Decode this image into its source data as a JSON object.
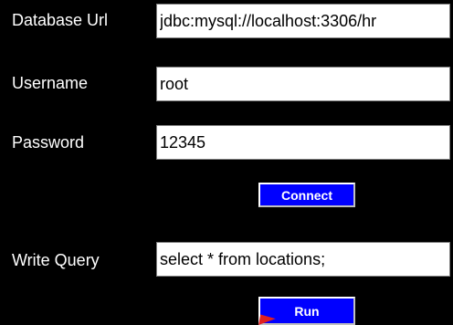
{
  "form": {
    "db_url": {
      "label": "Database Url",
      "value": "jdbc:mysql://localhost:3306/hr"
    },
    "username": {
      "label": "Username",
      "value": "root"
    },
    "password": {
      "label": "Password",
      "value": "12345"
    },
    "connect_label": "Connect",
    "query": {
      "label": "Write Query",
      "value": "select * from locations;"
    },
    "run_label": "Run"
  },
  "colors": {
    "background": "#000000",
    "button": "#0000ff",
    "field": "#ffffff",
    "cursor": "#e02020"
  },
  "icons": {
    "cursor": "mouse-cursor-icon"
  }
}
